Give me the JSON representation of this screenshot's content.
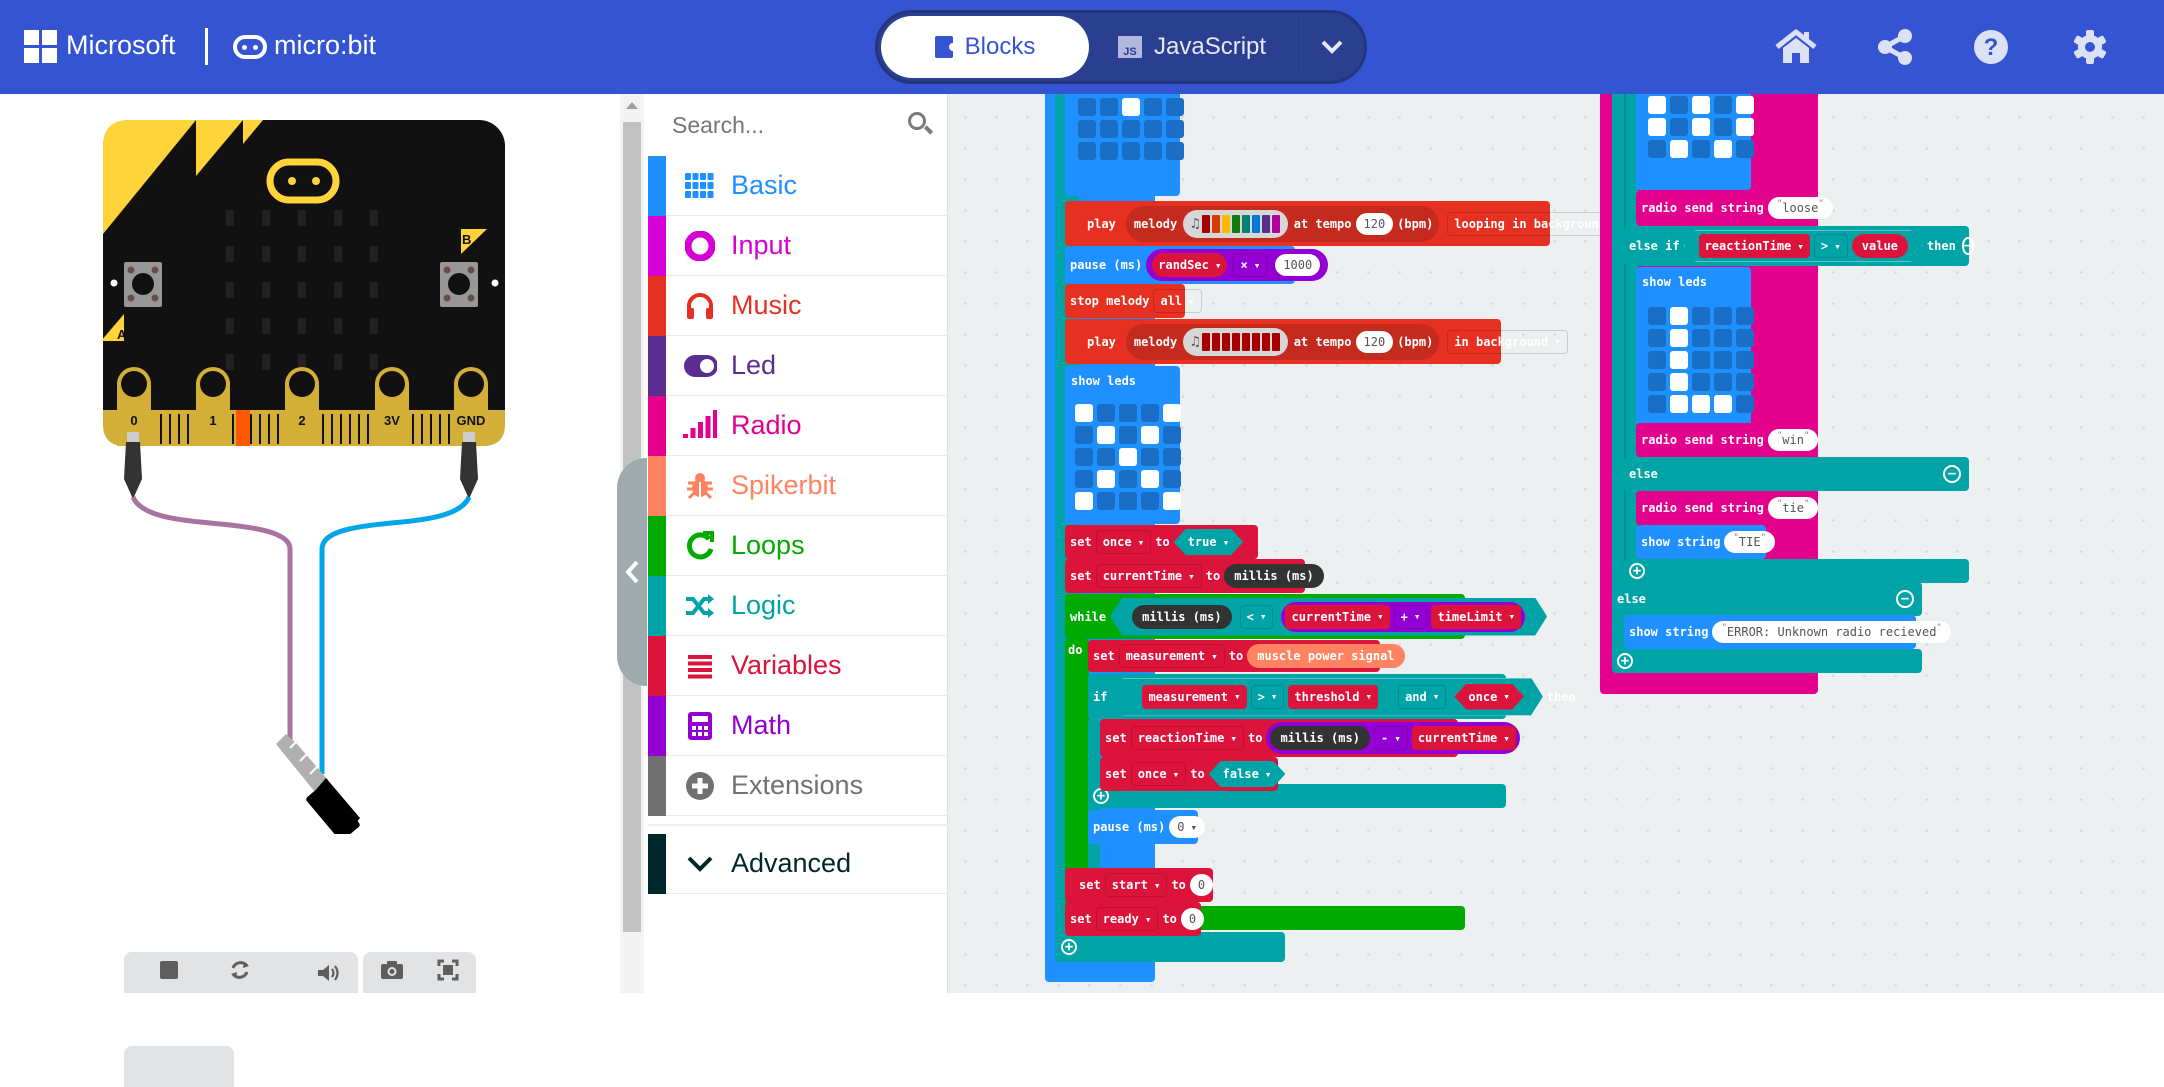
{
  "header": {
    "brand_microsoft": "Microsoft",
    "brand_microbit": "micro:bit",
    "tabs": [
      {
        "label": "Blocks",
        "active": true,
        "icon": "puzzle-icon"
      },
      {
        "label": "JavaScript",
        "active": false,
        "icon": "js-icon"
      }
    ],
    "mode_dropdown_icon": "chevron-down-icon",
    "icons": [
      "home-icon",
      "share-icon",
      "help-icon",
      "gear-icon"
    ],
    "color": "#3454d1"
  },
  "simulator": {
    "pins": [
      "0",
      "1",
      "2",
      "3V",
      "GND"
    ],
    "buttons": [
      "A",
      "B"
    ],
    "toolbar": [
      "stop-icon",
      "restart-icon",
      "debug-icon",
      "mute-icon",
      "screenshot-icon",
      "fullscreen-icon"
    ]
  },
  "toolbox": {
    "search_placeholder": "Search...",
    "categories": [
      {
        "label": "Basic",
        "color": "#1e90ff",
        "icon": "grid-icon"
      },
      {
        "label": "Input",
        "color": "#d400d4",
        "icon": "input-circle-icon"
      },
      {
        "label": "Music",
        "color": "#e63022",
        "icon": "headphones-icon"
      },
      {
        "label": "Led",
        "color": "#5c2d91",
        "icon": "toggle-icon"
      },
      {
        "label": "Radio",
        "color": "#e3008c",
        "icon": "signal-bars-icon"
      },
      {
        "label": "Spikerbit",
        "color": "#ff8360",
        "icon": "bug-icon"
      },
      {
        "label": "Loops",
        "color": "#00aa00",
        "icon": "loop-arrow-icon"
      },
      {
        "label": "Logic",
        "color": "#00a4a6",
        "icon": "shuffle-icon"
      },
      {
        "label": "Variables",
        "color": "#dc143c",
        "icon": "list-lines-icon"
      },
      {
        "label": "Math",
        "color": "#9400d3",
        "icon": "calculator-icon"
      },
      {
        "label": "Extensions",
        "color": "#717171",
        "icon": "plus-circle-icon"
      }
    ],
    "advanced": {
      "label": "Advanced",
      "color": "#00272b",
      "icon": "chevron-down-icon"
    }
  },
  "workspace": {
    "left": {
      "led_top": [
        0,
        0,
        0,
        0,
        0,
        0,
        0,
        1,
        0,
        0,
        0,
        0,
        0,
        0,
        0,
        0,
        0,
        0,
        0,
        0
      ],
      "play1": {
        "kw": "play",
        "melody": "melody",
        "at": "at tempo",
        "tempo": "120",
        "bpm": "(bpm)",
        "mode": "looping in background"
      },
      "pause1": {
        "kw": "pause (ms)",
        "var": "randSec",
        "op": "×",
        "val": "1000"
      },
      "stop": {
        "kw": "stop melody",
        "opt": "all"
      },
      "play2": {
        "kw": "play",
        "melody": "melody",
        "at": "at tempo",
        "tempo": "120",
        "bpm": "(bpm)",
        "mode": "in background"
      },
      "showleds": {
        "label": "show leds",
        "grid": [
          1,
          0,
          0,
          0,
          1,
          0,
          1,
          0,
          1,
          0,
          0,
          0,
          1,
          0,
          0,
          0,
          1,
          0,
          1,
          0,
          1,
          0,
          0,
          0,
          1
        ]
      },
      "set_once": {
        "kw": "set",
        "var": "once",
        "to": "to",
        "val": "true"
      },
      "set_ct": {
        "kw": "set",
        "var": "currentTime",
        "to": "to",
        "val": "millis (ms)"
      },
      "while": {
        "kw": "while",
        "a": "millis (ms)",
        "op": "<",
        "b": "currentTime",
        "op2": "+",
        "c": "timeLimit",
        "do": "do"
      },
      "set_meas": {
        "kw": "set",
        "var": "measurement",
        "to": "to",
        "val": "muscle power signal"
      },
      "if": {
        "kw": "if",
        "a": "measurement",
        "op": ">",
        "b": "threshold",
        "and": "and",
        "c": "once",
        "then": "then"
      },
      "set_rt": {
        "kw": "set",
        "var": "reactionTime",
        "to": "to",
        "a": "millis (ms)",
        "op": "-",
        "b": "currentTime"
      },
      "set_once2": {
        "kw": "set",
        "var": "once",
        "to": "to",
        "val": "false"
      },
      "pause2": {
        "kw": "pause (ms)",
        "val": "0"
      },
      "set_start": {
        "kw": "set",
        "var": "start",
        "to": "to",
        "val": "0"
      },
      "set_ready": {
        "kw": "set",
        "var": "ready",
        "to": "to",
        "val": "0"
      }
    },
    "right": {
      "led_top": [
        1,
        0,
        1,
        0,
        1,
        1,
        0,
        1,
        0,
        1,
        1,
        0,
        1,
        0,
        1,
        0,
        1,
        0,
        1,
        0
      ],
      "send_loose": {
        "kw": "radio send string",
        "val": "loose"
      },
      "elseif": {
        "kw": "else if",
        "a": "reactionTime",
        "op": ">",
        "b": "value",
        "then": "then"
      },
      "showleds": {
        "label": "show leds",
        "grid": [
          0,
          1,
          0,
          0,
          0,
          0,
          1,
          0,
          0,
          0,
          0,
          1,
          0,
          0,
          0,
          0,
          1,
          0,
          0,
          0,
          0,
          1,
          1,
          1,
          0
        ]
      },
      "send_win": {
        "kw": "radio send string",
        "val": "win"
      },
      "else1": "else",
      "send_tie": {
        "kw": "radio send string",
        "val": "tie"
      },
      "show_tie": {
        "kw": "show string",
        "val": "TIE"
      },
      "else2": "else",
      "show_err": {
        "kw": "show string",
        "val": "ERROR: Unknown radio recieved"
      }
    },
    "colors": {
      "basic": "#1e90ff",
      "music": "#e63022",
      "variables": "#dc143c",
      "logic": "#00a4a6",
      "loops": "#00aa00",
      "math": "#9400d3",
      "radio": "#e3008c",
      "spikerbit": "#ff8360",
      "advanced": "#333333"
    }
  }
}
